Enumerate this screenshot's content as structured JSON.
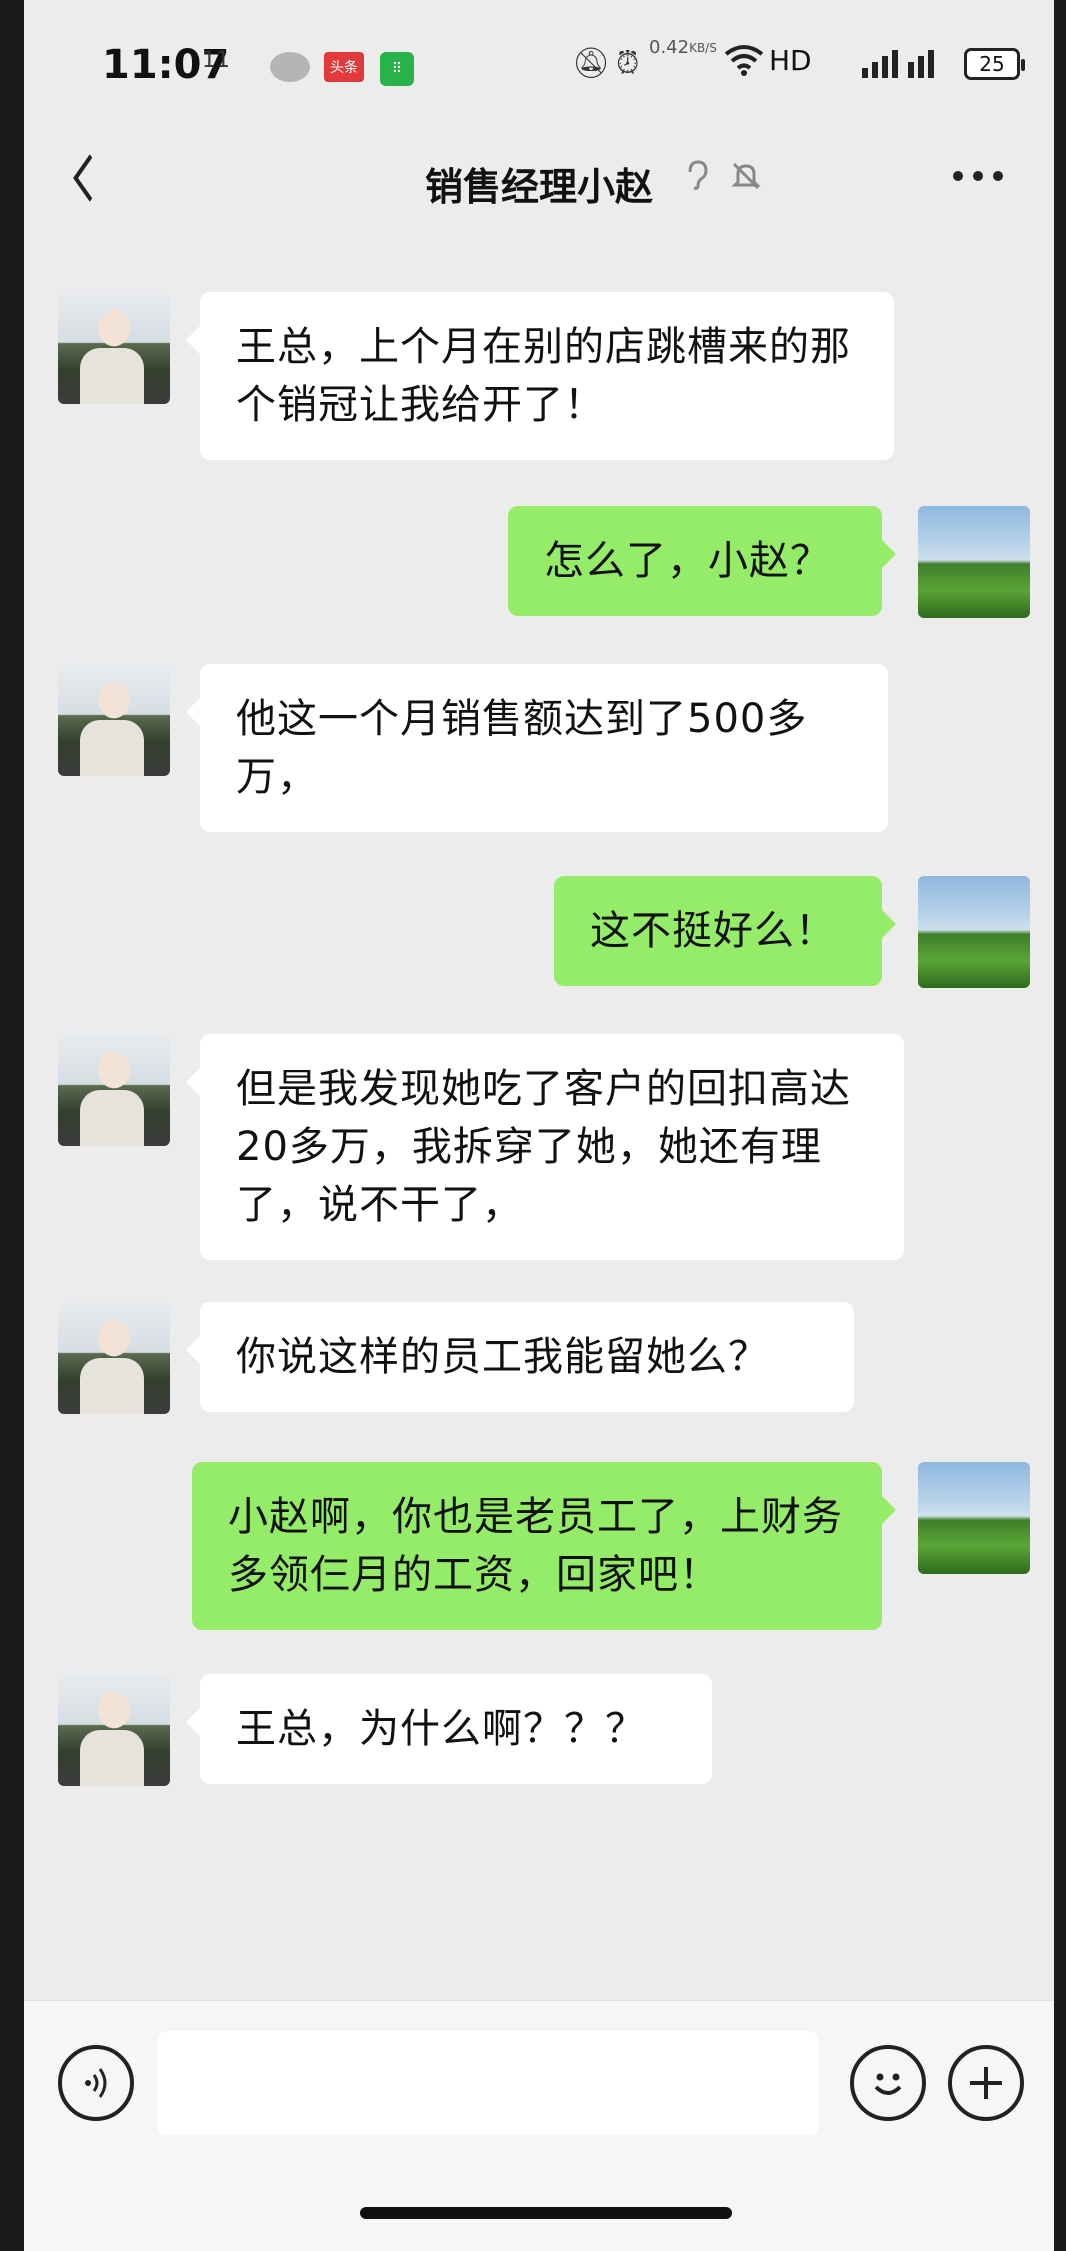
{
  "status_bar": {
    "time": "11:07",
    "extra_icon": "11",
    "toutiao_label": "头条",
    "speed_value": "0.42",
    "speed_unit": "KB/S",
    "network": "HD",
    "battery": "25",
    "icons": [
      "wechat-icon",
      "toutiao-icon",
      "app-icon",
      "mute-icon",
      "alarm-icon",
      "wifi-icon",
      "signal-icon",
      "battery-icon"
    ]
  },
  "header": {
    "title": "销售经理小赵",
    "back_icon": "chevron-left-icon",
    "more_icon": "more-icon",
    "ear_icon": "ear-icon",
    "mute_icon": "bell-off-icon"
  },
  "messages": [
    {
      "side": "left",
      "text": "王总，上个月在别的店跳槽来的那个销冠让我给开了！"
    },
    {
      "side": "right",
      "text": "怎么了，小赵？"
    },
    {
      "side": "left",
      "text": "他这一个月销售额达到了500多万，"
    },
    {
      "side": "right",
      "text": "这不挺好么！"
    },
    {
      "side": "left",
      "text": "但是我发现她吃了客户的回扣高达20多万，我拆穿了她，她还有理了，说不干了，"
    },
    {
      "side": "left",
      "text": "你说这样的员工我能留她么？"
    },
    {
      "side": "right",
      "text": "小赵啊，你也是老员工了，上财务多领仨月的工资，回家吧！"
    },
    {
      "side": "left",
      "text": "王总，为什么啊？？？"
    }
  ],
  "input_bar": {
    "voice_icon": "voice-icon",
    "emoji_icon": "emoji-icon",
    "plus_icon": "plus-icon",
    "placeholder": ""
  },
  "colors": {
    "background": "#ececec",
    "bubble_self": "#95ec69",
    "bubble_other": "#ffffff"
  }
}
